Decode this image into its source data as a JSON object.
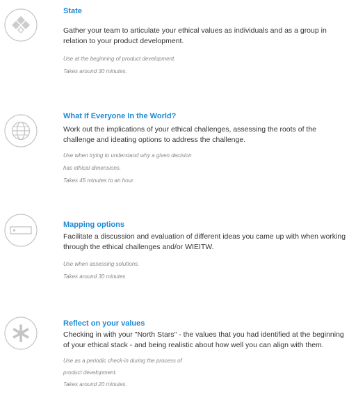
{
  "colors": {
    "title": "#1f8ad4",
    "body_text": "#333333",
    "note_text": "#888888",
    "icon_stroke": "#c4c4c4",
    "icon_fill": "#cdcdcd"
  },
  "methods": [
    {
      "icon": "diamond-quad-icon",
      "title": "State",
      "description": "Gather your team to articulate your ethical values as individuals and as a group in relation to your product development.",
      "notes": [
        "Use at the beginning of product development.",
        "Takes around 30 minutes."
      ]
    },
    {
      "icon": "globe-icon",
      "title": "What If Everyone In the World?",
      "description": "Work out the implications of your ethical challenges, assessing the roots of the challenge and ideating options to address the challenge.",
      "notes": [
        "Use when trying to understand why a given decision",
        "has ethical dimensions.",
        "Takes  45 minutes to an hour."
      ]
    },
    {
      "icon": "rectangle-card-icon",
      "title": "Mapping options",
      "description": "Facilitate a discussion and evaluation of different ideas you came up with when working through the ethical challenges and/or WIEITW.",
      "notes": [
        "Use when assessing solutions.",
        "Takes around 30 minutes"
      ]
    },
    {
      "icon": "asterisk-icon",
      "title": "Reflect on your values",
      "description": "Checking in with your \"North Stars\" - the values that you had identified at the beginning of your ethical stack - and being realistic about how well you can align with them.",
      "notes": [
        "Use as a periodic check-in during the process of",
        "product development.",
        "Takes around 20 minutes."
      ]
    }
  ]
}
